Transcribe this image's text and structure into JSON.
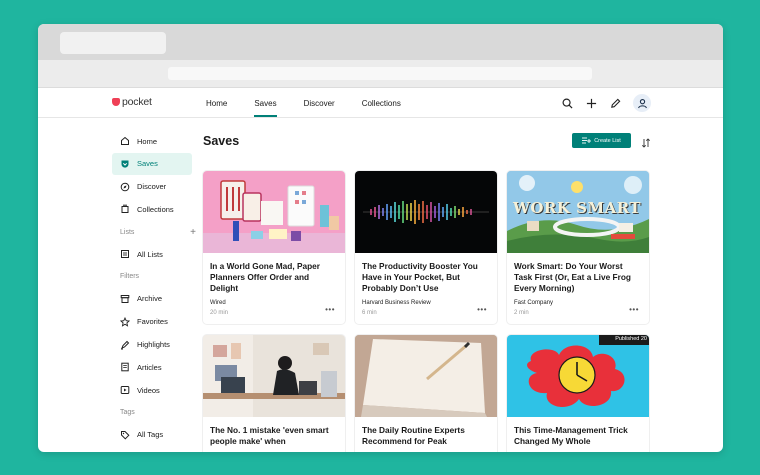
{
  "colors": {
    "background": "#1fb59f",
    "accent": "#008078",
    "brand": "#ef4056"
  },
  "app": {
    "logo_text": "pocket"
  },
  "top_nav": [
    {
      "label": "Home",
      "active": false
    },
    {
      "label": "Saves",
      "active": true
    },
    {
      "label": "Discover",
      "active": false
    },
    {
      "label": "Collections",
      "active": false
    }
  ],
  "header_icons": [
    "search-icon",
    "plus-icon",
    "pencil-icon",
    "avatar-icon"
  ],
  "sidebar": {
    "nav": [
      {
        "label": "Home",
        "icon": "home-icon"
      },
      {
        "label": "Saves",
        "icon": "saves-icon",
        "active": true
      },
      {
        "label": "Discover",
        "icon": "compass-icon"
      },
      {
        "label": "Collections",
        "icon": "collections-icon"
      }
    ],
    "lists_heading": "Lists",
    "lists": [
      {
        "label": "All Lists",
        "icon": "list-icon"
      }
    ],
    "filters_heading": "Filters",
    "filters": [
      {
        "label": "Archive",
        "icon": "archive-icon"
      },
      {
        "label": "Favorites",
        "icon": "star-icon"
      },
      {
        "label": "Highlights",
        "icon": "highlighter-icon"
      },
      {
        "label": "Articles",
        "icon": "article-icon"
      },
      {
        "label": "Videos",
        "icon": "video-icon"
      }
    ],
    "tags_heading": "Tags",
    "tags": [
      {
        "label": "All Tags",
        "icon": "tag-icon"
      }
    ]
  },
  "main": {
    "title": "Saves",
    "create_list_label": "Create List",
    "cards": [
      {
        "title": "In a World Gone Mad, Paper Planners Offer Order and Delight",
        "source": "Wired",
        "time": "20 min"
      },
      {
        "title": "The Productivity Booster You Have in Your Pocket, But Probably Don’t Use",
        "source": "Harvard Business Review",
        "time": "6 min"
      },
      {
        "title": "Work Smart: Do Your Worst Task First (Or, Eat a Live Frog Every Morning)",
        "source": "Fast Company",
        "time": "2 min",
        "image_text": "WORK SMART"
      },
      {
        "title": "The No. 1 mistake 'even smart people make' when",
        "source": "",
        "time": ""
      },
      {
        "title": "The Daily Routine Experts Recommend for Peak",
        "source": "",
        "time": ""
      },
      {
        "title": "This Time-Management Trick Changed My Whole",
        "source": "",
        "time": "",
        "image_badge": "Published 20"
      }
    ],
    "more_label": "•••"
  }
}
